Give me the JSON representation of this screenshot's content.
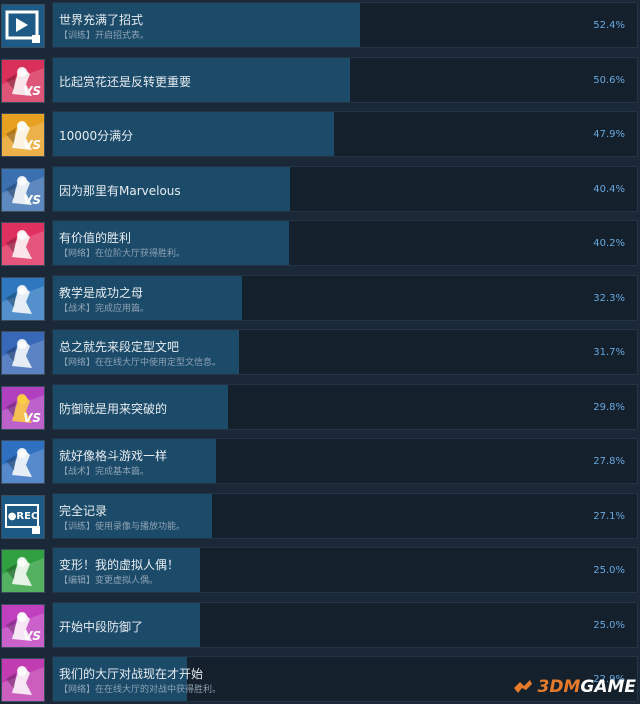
{
  "achievements": [
    {
      "title": "世界充满了招式",
      "desc": "【训练】开启招式表。",
      "percent": "52.4%",
      "icon": "play-video-icon",
      "color": "#1e5a86",
      "accent": "#ffffff",
      "badge": ""
    },
    {
      "title": "比起赏花还是反转更重要",
      "desc": "",
      "percent": "50.6%",
      "icon": "versus-character-icon",
      "color": "#d8305a",
      "accent": "#ffffff",
      "badge": "VS"
    },
    {
      "title": "10000分满分",
      "desc": "",
      "percent": "47.9%",
      "icon": "versus-character-icon",
      "color": "#e8a020",
      "accent": "#ffffff",
      "badge": "VS"
    },
    {
      "title": "因为那里有Marvelous",
      "desc": "",
      "percent": "40.4%",
      "icon": "versus-character-icon",
      "color": "#3a6fb0",
      "accent": "#ffffff",
      "badge": "VS"
    },
    {
      "title": "有价值的胜利",
      "desc": "【网络】在位阶大厅获得胜利。",
      "percent": "40.2%",
      "icon": "versus-character-icon",
      "color": "#e03060",
      "accent": "#ffffff",
      "badge": ""
    },
    {
      "title": "教学是成功之母",
      "desc": "【战术】完成应用篇。",
      "percent": "32.3%",
      "icon": "versus-character-icon",
      "color": "#2f78c0",
      "accent": "#ffffff",
      "badge": ""
    },
    {
      "title": "总之就先来段定型文吧",
      "desc": "【网络】在在线大厅中使用定型文信息。",
      "percent": "31.7%",
      "icon": "versus-character-icon",
      "color": "#3868b8",
      "accent": "#ffffff",
      "badge": ""
    },
    {
      "title": "防御就是用来突破的",
      "desc": "",
      "percent": "29.8%",
      "icon": "versus-character-icon",
      "color": "#b040c0",
      "accent": "#ffd040",
      "badge": "VS"
    },
    {
      "title": "就好像格斗游戏一样",
      "desc": "【战术】完成基本篇。",
      "percent": "27.8%",
      "icon": "versus-character-icon",
      "color": "#3070c0",
      "accent": "#ffffff",
      "badge": ""
    },
    {
      "title": "完全记录",
      "desc": "【训练】使用录像与播放功能。",
      "percent": "27.1%",
      "icon": "record-icon",
      "color": "#1e5a86",
      "accent": "#ffffff",
      "badge": "●REC"
    },
    {
      "title": "变形！我的虚拟人偶！",
      "desc": "【编辑】变更虚拟人偶。",
      "percent": "25.0%",
      "icon": "versus-character-icon",
      "color": "#30a040",
      "accent": "#ffffff",
      "badge": ""
    },
    {
      "title": "开始中段防御了",
      "desc": "",
      "percent": "25.0%",
      "icon": "versus-character-icon",
      "color": "#c040c0",
      "accent": "#ffffff",
      "badge": "VS"
    },
    {
      "title": "我们的大厅对战现在才开始",
      "desc": "【网络】在在线大厅的对战中获得胜利。",
      "percent": "22.9%",
      "icon": "versus-character-icon",
      "color": "#c03cb0",
      "accent": "#ffffff",
      "badge": ""
    }
  ],
  "watermark": {
    "brand_a": "3DM",
    "brand_b": "GAME"
  }
}
